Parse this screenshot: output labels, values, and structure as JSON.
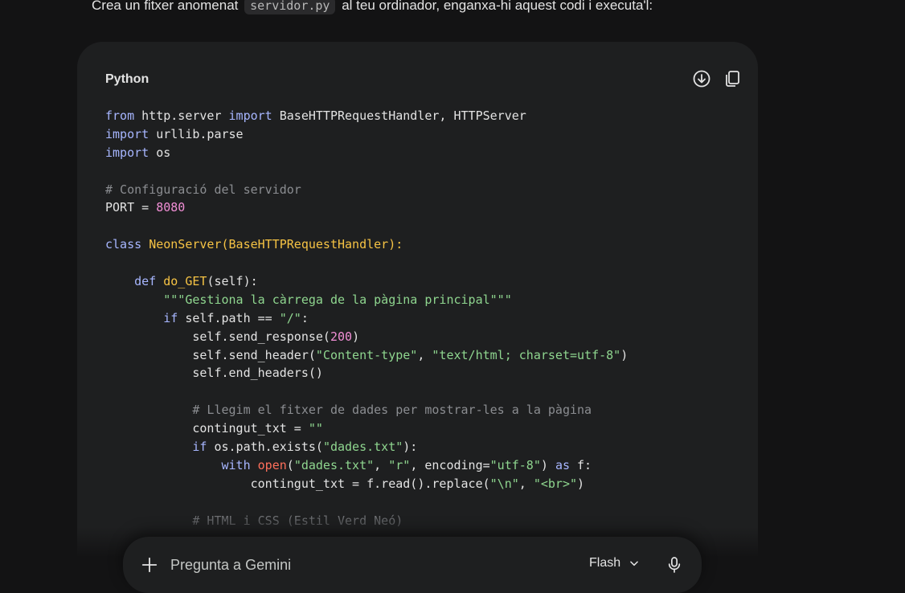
{
  "intro": {
    "before": "Crea un fitxer anomenat",
    "filename": "servidor.py",
    "after": "al teu ordinador, enganxa-hi aquest codi i executa'l:"
  },
  "code_block": {
    "language": "Python",
    "download_icon": "download-icon",
    "copy_icon": "copy-icon",
    "lines": [
      [
        [
          "kw",
          "from"
        ],
        [
          "p",
          " http.server "
        ],
        [
          "kw",
          "import"
        ],
        [
          "p",
          " BaseHTTPRequestHandler, HTTPServer"
        ]
      ],
      [
        [
          "kw",
          "import"
        ],
        [
          "p",
          " urllib.parse"
        ]
      ],
      [
        [
          "kw",
          "import"
        ],
        [
          "p",
          " os"
        ]
      ],
      [],
      [
        [
          "com",
          "# Configuració del servidor"
        ]
      ],
      [
        [
          "p",
          "PORT = "
        ],
        [
          "num",
          "8080"
        ]
      ],
      [],
      [
        [
          "kw",
          "class"
        ],
        [
          "p",
          " "
        ],
        [
          "fn",
          "NeonServer(BaseHTTPRequestHandler):"
        ]
      ],
      [],
      [
        [
          "p",
          "    "
        ],
        [
          "kw",
          "def"
        ],
        [
          "p",
          " "
        ],
        [
          "fn",
          "do_GET"
        ],
        [
          "p",
          "(self):"
        ]
      ],
      [
        [
          "p",
          "        "
        ],
        [
          "str",
          "\"\"\"Gestiona la càrrega de la pàgina principal\"\"\""
        ]
      ],
      [
        [
          "p",
          "        "
        ],
        [
          "kw",
          "if"
        ],
        [
          "p",
          " self.path == "
        ],
        [
          "str",
          "\"/\""
        ],
        [
          "p",
          ":"
        ]
      ],
      [
        [
          "p",
          "            self.send_response("
        ],
        [
          "num",
          "200"
        ],
        [
          "p",
          ")"
        ]
      ],
      [
        [
          "p",
          "            self.send_header("
        ],
        [
          "str",
          "\"Content-type\""
        ],
        [
          "p",
          ", "
        ],
        [
          "str",
          "\"text/html; charset=utf-8\""
        ],
        [
          "p",
          ")"
        ]
      ],
      [
        [
          "p",
          "            self.end_headers()"
        ]
      ],
      [],
      [
        [
          "p",
          "            "
        ],
        [
          "com",
          "# Llegim el fitxer de dades per mostrar-les a la pàgina"
        ]
      ],
      [
        [
          "p",
          "            contingut_txt = "
        ],
        [
          "str",
          "\"\""
        ]
      ],
      [
        [
          "p",
          "            "
        ],
        [
          "kw",
          "if"
        ],
        [
          "p",
          " os.path.exists("
        ],
        [
          "str",
          "\"dades.txt\""
        ],
        [
          "p",
          "):"
        ]
      ],
      [
        [
          "p",
          "                "
        ],
        [
          "kw",
          "with"
        ],
        [
          "p",
          " "
        ],
        [
          "bi",
          "open"
        ],
        [
          "p",
          "("
        ],
        [
          "str",
          "\"dades.txt\""
        ],
        [
          "p",
          ", "
        ],
        [
          "str",
          "\"r\""
        ],
        [
          "p",
          ", encoding="
        ],
        [
          "str",
          "\"utf-8\""
        ],
        [
          "p",
          ") "
        ],
        [
          "kw",
          "as"
        ],
        [
          "p",
          " f:"
        ]
      ],
      [
        [
          "p",
          "                    contingut_txt = f.read().replace("
        ],
        [
          "str",
          "\"\\n\""
        ],
        [
          "p",
          ", "
        ],
        [
          "str",
          "\"<br>\""
        ],
        [
          "p",
          ")"
        ]
      ],
      [],
      [
        [
          "p",
          "            "
        ],
        [
          "com",
          "# HTML i CSS (Estil Verd Neó)"
        ]
      ]
    ]
  },
  "prompt_bar": {
    "add_icon": "plus-icon",
    "placeholder": "Pregunta a Gemini",
    "model_label": "Flash",
    "model_icon": "chevron-down-icon",
    "mic_icon": "microphone-icon"
  },
  "colors": {
    "background": "#131314",
    "card": "#1e1f20",
    "keyword": "#a7b6ff",
    "function": "#f6c344",
    "string": "#8fd68f",
    "number": "#f28fd6",
    "comment": "#8b8d91",
    "builtin": "#ff6f5b"
  }
}
